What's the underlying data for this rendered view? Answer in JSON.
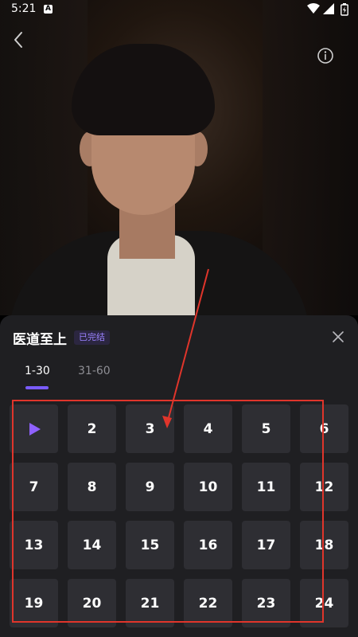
{
  "status_bar": {
    "time": "5:21",
    "a_icon": "A"
  },
  "header": {
    "back_icon": "chevron-left-icon",
    "info_icon": "info-circle-icon"
  },
  "sheet": {
    "title": "医道至上",
    "badge": "已完结",
    "tabs": [
      {
        "label": "1-30",
        "active": true
      },
      {
        "label": "31-60",
        "active": false
      }
    ],
    "episodes": [
      {
        "label": "",
        "playing": true
      },
      {
        "label": "2"
      },
      {
        "label": "3"
      },
      {
        "label": "4"
      },
      {
        "label": "5"
      },
      {
        "label": "6"
      },
      {
        "label": "7"
      },
      {
        "label": "8"
      },
      {
        "label": "9"
      },
      {
        "label": "10"
      },
      {
        "label": "11"
      },
      {
        "label": "12"
      },
      {
        "label": "13"
      },
      {
        "label": "14"
      },
      {
        "label": "15"
      },
      {
        "label": "16"
      },
      {
        "label": "17"
      },
      {
        "label": "18"
      },
      {
        "label": "19"
      },
      {
        "label": "20"
      },
      {
        "label": "21"
      },
      {
        "label": "22"
      },
      {
        "label": "23"
      },
      {
        "label": "24"
      }
    ]
  },
  "colors": {
    "accent": "#7a5cff",
    "sheet_bg": "#1f1f22",
    "cell_bg": "#2e2e33",
    "annotation_red": "#e0352b"
  }
}
